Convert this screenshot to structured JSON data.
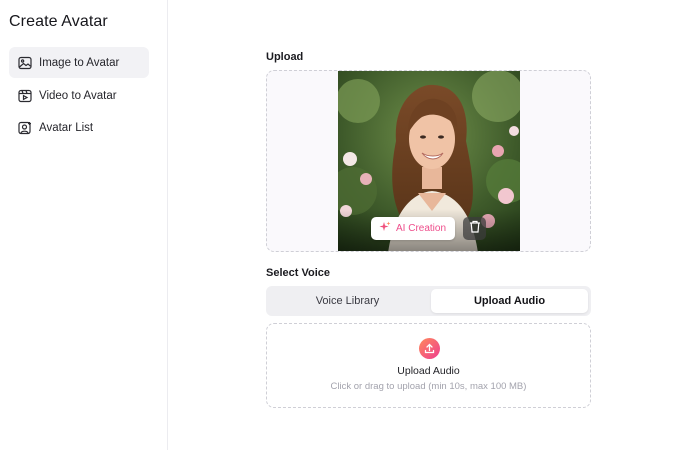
{
  "sidebar": {
    "title": "Create Avatar",
    "items": [
      {
        "label": "Image to Avatar",
        "icon": "image-icon",
        "active": true
      },
      {
        "label": "Video to Avatar",
        "icon": "video-icon",
        "active": false
      },
      {
        "label": "Avatar List",
        "icon": "avatar-list-icon",
        "active": false
      }
    ]
  },
  "main": {
    "upload": {
      "label": "Upload",
      "ai_creation_label": "AI Creation",
      "delete_icon": "trash-icon"
    },
    "voice": {
      "label": "Select Voice",
      "tabs": [
        {
          "label": "Voice Library",
          "active": false
        },
        {
          "label": "Upload Audio",
          "active": true
        }
      ],
      "upload_title": "Upload Audio",
      "upload_hint": "Click or drag to upload (min 10s, max 100 MB)"
    }
  },
  "colors": {
    "accent_pink": "#ee4d8b",
    "accent_orange": "#ff8a5c",
    "active_nav_bg": "#f2f2f5"
  }
}
